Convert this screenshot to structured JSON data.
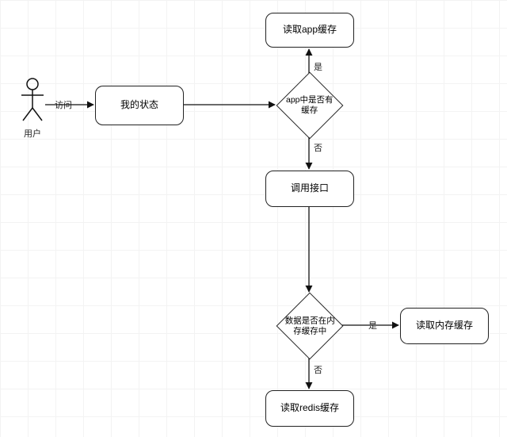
{
  "actor": {
    "label": "用户"
  },
  "edges": {
    "visit": "访问",
    "yes": "是",
    "no": "否"
  },
  "nodes": {
    "myState": "我的状态",
    "readAppCache": "读取app缓存",
    "decisionAppCache": "app中是否有\n缓存",
    "callApi": "调用接口",
    "decisionMem": "数据是否在内\n存缓存中",
    "readMemCache": "读取内存缓存",
    "readRedis": "读取redis缓存"
  }
}
